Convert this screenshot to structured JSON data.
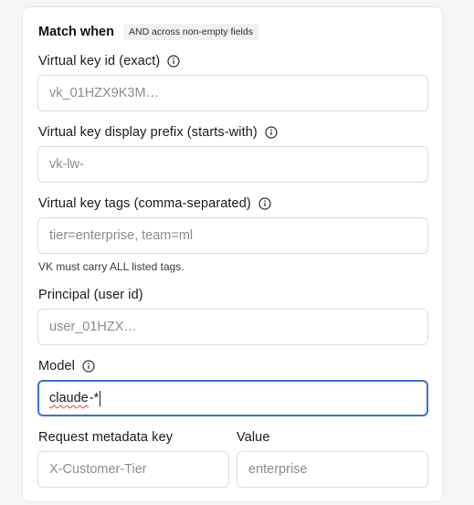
{
  "section": {
    "title": "Match when",
    "badge": "AND across non-empty fields"
  },
  "fields": {
    "vk_id": {
      "label": "Virtual key id (exact)",
      "placeholder": "vk_01HZX9K3M…",
      "value": ""
    },
    "vk_prefix": {
      "label": "Virtual key display prefix (starts-with)",
      "placeholder": "vk-lw-",
      "value": ""
    },
    "vk_tags": {
      "label": "Virtual key tags (comma-separated)",
      "placeholder": "tier=enterprise, team=ml",
      "value": "",
      "hint": "VK must carry ALL listed tags."
    },
    "principal": {
      "label": "Principal (user id)",
      "placeholder": "user_01HZX…",
      "value": ""
    },
    "model": {
      "label": "Model",
      "value_word": "claude",
      "value_rest": "-*"
    },
    "metadata_key": {
      "label": "Request metadata key",
      "placeholder": "X-Customer-Tier"
    },
    "metadata_value": {
      "label": "Value",
      "placeholder": "enterprise"
    }
  },
  "icons": {
    "info": "info-circle-icon"
  },
  "colors": {
    "focus_border": "#3b6fd6",
    "spellcheck_underline": "#e0453a",
    "badge_bg": "#f1f1f3"
  }
}
